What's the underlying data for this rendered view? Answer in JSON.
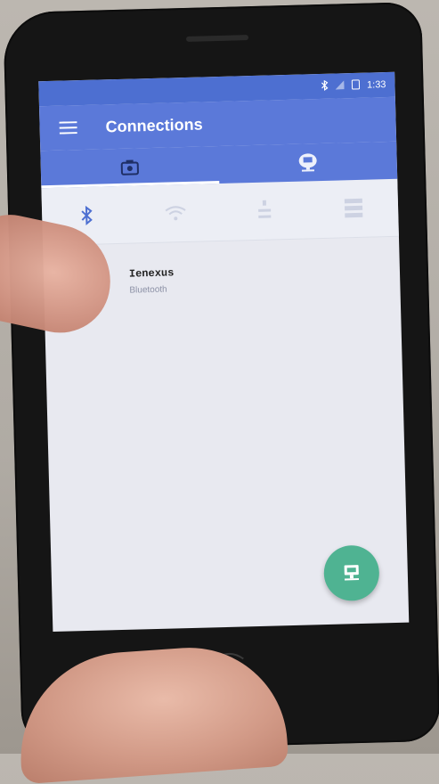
{
  "status_bar": {
    "time": "1:33",
    "icons": [
      "bluetooth-icon",
      "signal-icon",
      "battery-icon"
    ]
  },
  "toolbar": {
    "title": "Connections",
    "menu_icon": "menu-icon"
  },
  "tabs": [
    {
      "icon": "device-icon",
      "active": true
    },
    {
      "icon": "network-icon",
      "active": false
    }
  ],
  "connection_types": [
    {
      "icon": "bluetooth-icon",
      "selected": true
    },
    {
      "icon": "wifi-icon",
      "selected": false
    },
    {
      "icon": "usb-icon",
      "selected": false
    },
    {
      "icon": "server-icon",
      "selected": false
    }
  ],
  "devices": [
    {
      "name": "Ienexus",
      "type": "Bluetooth"
    }
  ],
  "fab": {
    "icon": "network-icon"
  },
  "colors": {
    "primary": "#5b79d9",
    "status_bar": "#4d6fd1",
    "fab": "#4fb392",
    "background": "#e8e9f0"
  }
}
